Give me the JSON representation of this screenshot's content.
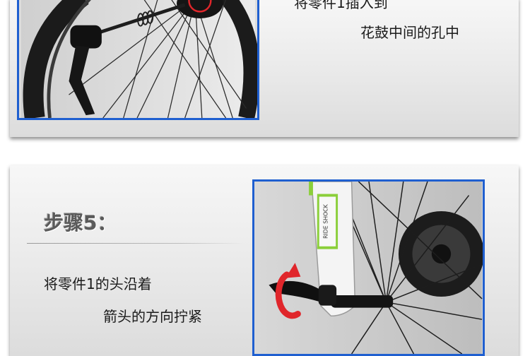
{
  "top_panel": {
    "line1": "将零件1插入到",
    "line2": "花鼓中间的孔中"
  },
  "bottom_panel": {
    "step_title": "步骤5：",
    "line1": "将零件1的头沿着",
    "line2": "箭头的方向拧紧",
    "fork_sticker": "RIDE SHOCK"
  },
  "colors": {
    "photo_border": "#1f5fd0",
    "arrow": "#e0262b",
    "sticker": "#8bcf3a"
  }
}
